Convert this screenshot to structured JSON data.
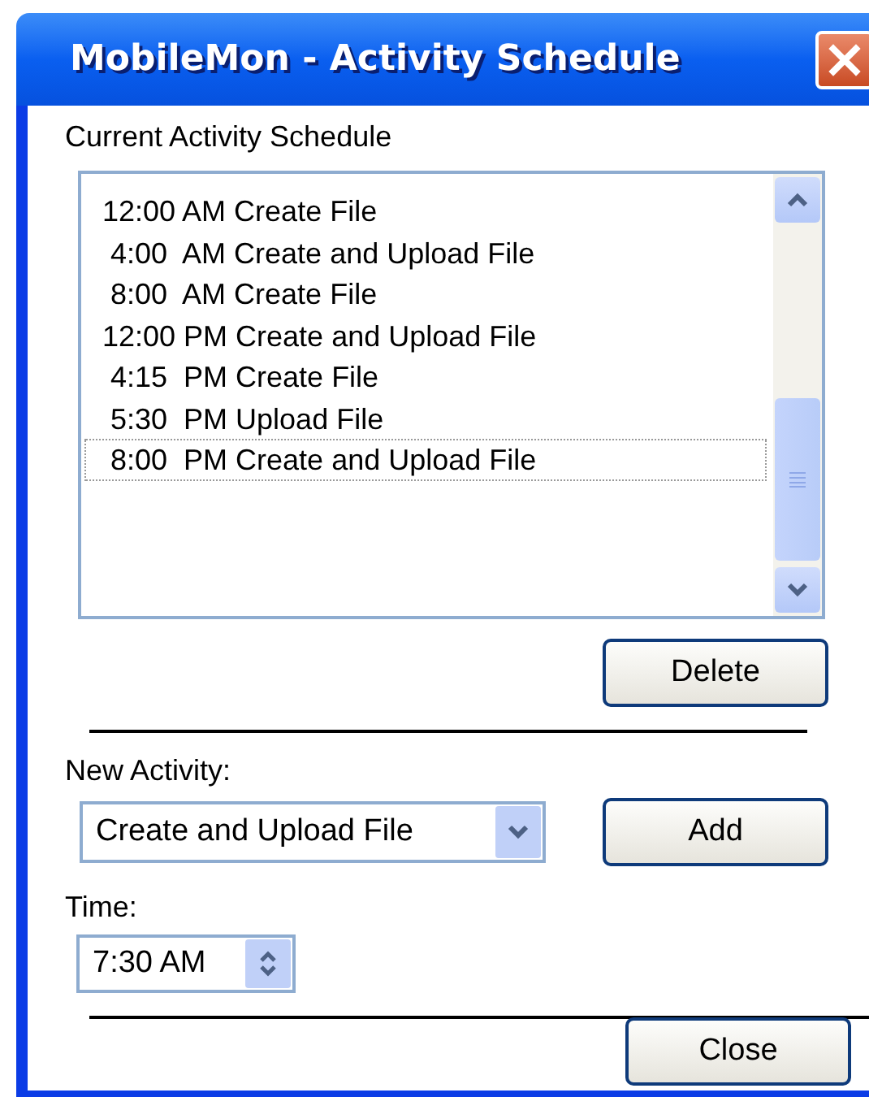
{
  "window": {
    "title": "MobileMon - Activity Schedule"
  },
  "schedule": {
    "label": "Current Activity Schedule",
    "items": [
      {
        "text": "12:00 AM Create File",
        "selected": false
      },
      {
        "text": " 4:00  AM Create and Upload File",
        "selected": false
      },
      {
        "text": " 8:00  AM Create File",
        "selected": false
      },
      {
        "text": "12:00 PM Create and Upload File",
        "selected": false
      },
      {
        "text": " 4:15  PM Create File",
        "selected": false
      },
      {
        "text": " 5:30  PM Upload File",
        "selected": false
      },
      {
        "text": " 8:00  PM Create and Upload File",
        "selected": true
      }
    ]
  },
  "delete_button": "Delete",
  "new_activity": {
    "label": "New Activity:",
    "value": "Create and Upload File"
  },
  "add_button": "Add",
  "time": {
    "label": "Time:",
    "value": "7:30 AM"
  },
  "close_button": "Close"
}
